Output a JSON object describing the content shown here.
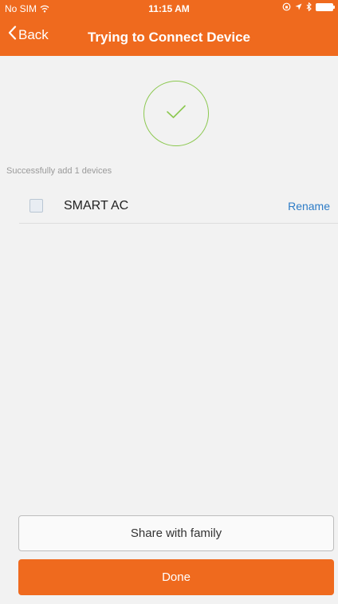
{
  "statusbar": {
    "carrier": "No SIM",
    "time": "11:15 AM"
  },
  "navbar": {
    "back_label": "Back",
    "title": "Trying to Connect Device"
  },
  "result": {
    "message": "Successfully add 1 devices"
  },
  "devices": [
    {
      "name": "SMART AC",
      "action_label": "Rename",
      "checked": false
    }
  ],
  "buttons": {
    "share_label": "Share with family",
    "done_label": "Done"
  },
  "colors": {
    "accent": "#ef6a1e",
    "success": "#8cc850",
    "link": "#2d7cc7",
    "background": "#f2f2f2"
  },
  "icons": [
    "wifi-icon",
    "orientation-lock-icon",
    "location-icon",
    "bluetooth-icon",
    "battery-icon",
    "chevron-left-icon",
    "checkmark-icon"
  ]
}
